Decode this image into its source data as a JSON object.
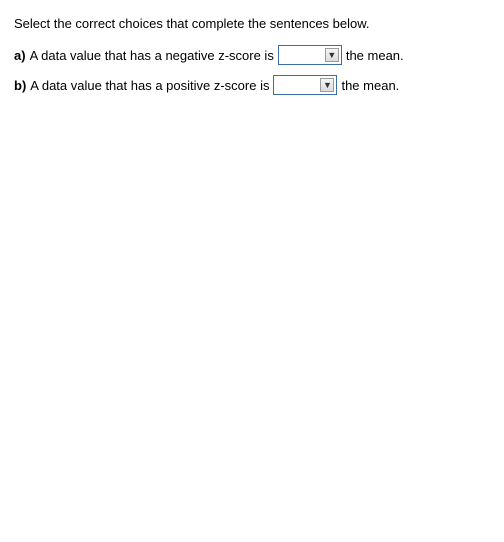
{
  "instructions": "Select the correct choices that complete the sentences below.",
  "questions": [
    {
      "label": "a)",
      "text_before": " A data value that has a negative z-score is ",
      "text_after": " the mean."
    },
    {
      "label": "b)",
      "text_before": " A data value that has a positive z-score is ",
      "text_after": " the mean."
    }
  ],
  "dropdown_glyph": "▼"
}
